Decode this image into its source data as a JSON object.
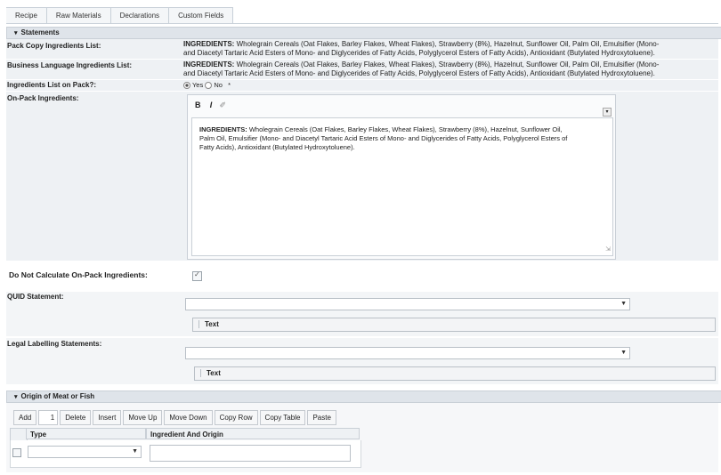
{
  "tabs": [
    "Recipe",
    "Raw Materials",
    "Declarations",
    "Custom Fields"
  ],
  "statements": {
    "section_title": "Statements",
    "pack_copy": {
      "label": "Pack Copy Ingredients List:",
      "prefix": "INGREDIENTS:",
      "line1": " Wholegrain Cereals (Oat Flakes, Barley Flakes, Wheat Flakes), Strawberry (8%), Hazelnut, Sunflower Oil, Palm Oil, Emulsifier (Mono-",
      "line2": "and Diacetyl Tartaric Acid Esters of Mono- and Diglycerides of Fatty Acids, Polyglycerol Esters of Fatty Acids), Antioxidant (Butylated Hydroxytoluene)."
    },
    "business_language": {
      "label": "Business Language Ingredients List:",
      "prefix": "INGREDIENTS:",
      "line1": " Wholegrain Cereals (Oat Flakes, Barley Flakes, Wheat Flakes), Strawberry (8%), Hazelnut, Sunflower Oil, Palm Oil, Emulsifier (Mono-",
      "line2": "and Diacetyl Tartaric Acid Esters of Mono- and Diglycerides of Fatty Acids, Polyglycerol Esters of Fatty Acids), Antioxidant (Butylated Hydroxytoluene)."
    },
    "ingredients_on_pack": {
      "label": "Ingredients List on Pack?:",
      "yes": "Yes",
      "no": "No",
      "required": "*"
    },
    "on_pack": {
      "label": "On-Pack Ingredients:",
      "toolbar_bold": "B",
      "toolbar_italic": "I",
      "prefix": "INGREDIENTS:",
      "line1": " Wholegrain Cereals (Oat Flakes, Barley Flakes, Wheat Flakes), Strawberry (8%), Hazelnut, Sunflower Oil,",
      "line2": "Palm Oil, Emulsifier (Mono- and Diacetyl Tartaric Acid Esters of Mono- and Diglycerides of Fatty Acids, Polyglycerol Esters of",
      "line3": "Fatty Acids), Antioxidant (Butylated Hydroxytoluene)."
    },
    "do_not_calculate": {
      "label": "Do Not Calculate On-Pack Ingredients:"
    },
    "quid": {
      "label": "QUID Statement:",
      "text_header": "Text"
    },
    "legal": {
      "label": "Legal Labelling Statements:",
      "text_header": "Text"
    }
  },
  "origin": {
    "section_title": "Origin of Meat or Fish",
    "toolbar": {
      "add": "Add",
      "add_count": "1",
      "delete": "Delete",
      "insert": "Insert",
      "move_up": "Move Up",
      "move_down": "Move Down",
      "copy_row": "Copy Row",
      "copy_table": "Copy Table",
      "paste": "Paste"
    },
    "columns": [
      "Type",
      "Ingredient And Origin"
    ]
  }
}
